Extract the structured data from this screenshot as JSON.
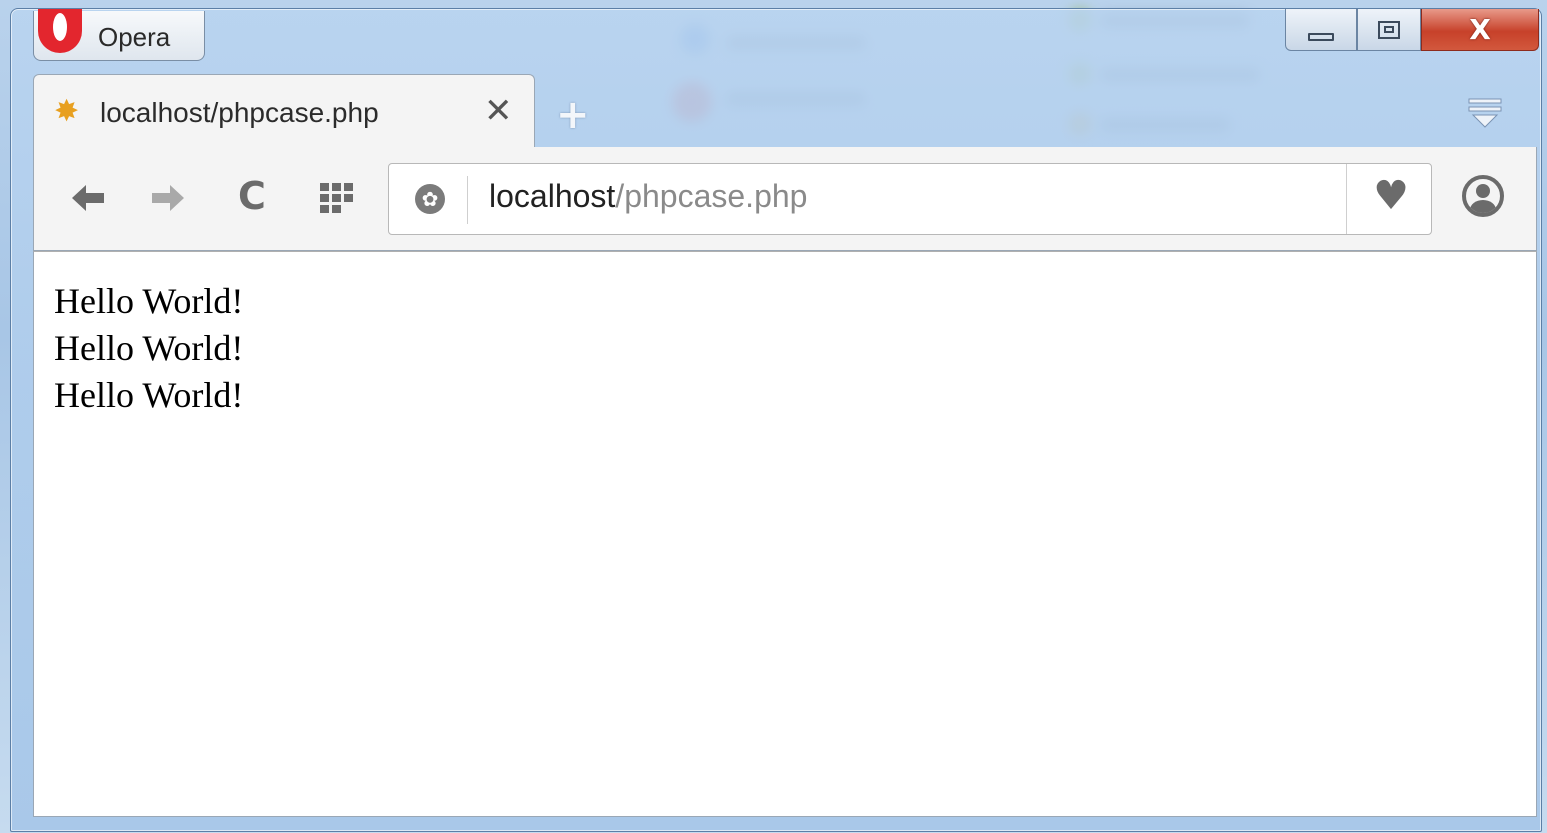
{
  "window": {
    "menu_label": "Opera",
    "controls": {
      "minimize_icon": "minimize-icon",
      "maximize_icon": "maximize-icon",
      "close_glyph": "X"
    }
  },
  "tabs": [
    {
      "title": "localhost/phpcase.php",
      "close_glyph": "✕",
      "favicon": "star-favicon-icon",
      "active": true
    }
  ],
  "new_tab_glyph": "+",
  "toolbar": {
    "back_glyph": "🡐",
    "forward_glyph": "🡒",
    "reload_glyph": "C",
    "speed_dial_icon": "grid-icon",
    "address": {
      "host": "localhost",
      "path": "/phpcase.php"
    },
    "heart_glyph": "♥",
    "account_icon": "account-icon"
  },
  "page": {
    "lines": [
      "Hello World!",
      "Hello World!",
      "Hello World!"
    ]
  },
  "colors": {
    "accent_red": "#e3262e",
    "close_button": "#c7412a",
    "chrome_gray": "#f4f4f4"
  }
}
